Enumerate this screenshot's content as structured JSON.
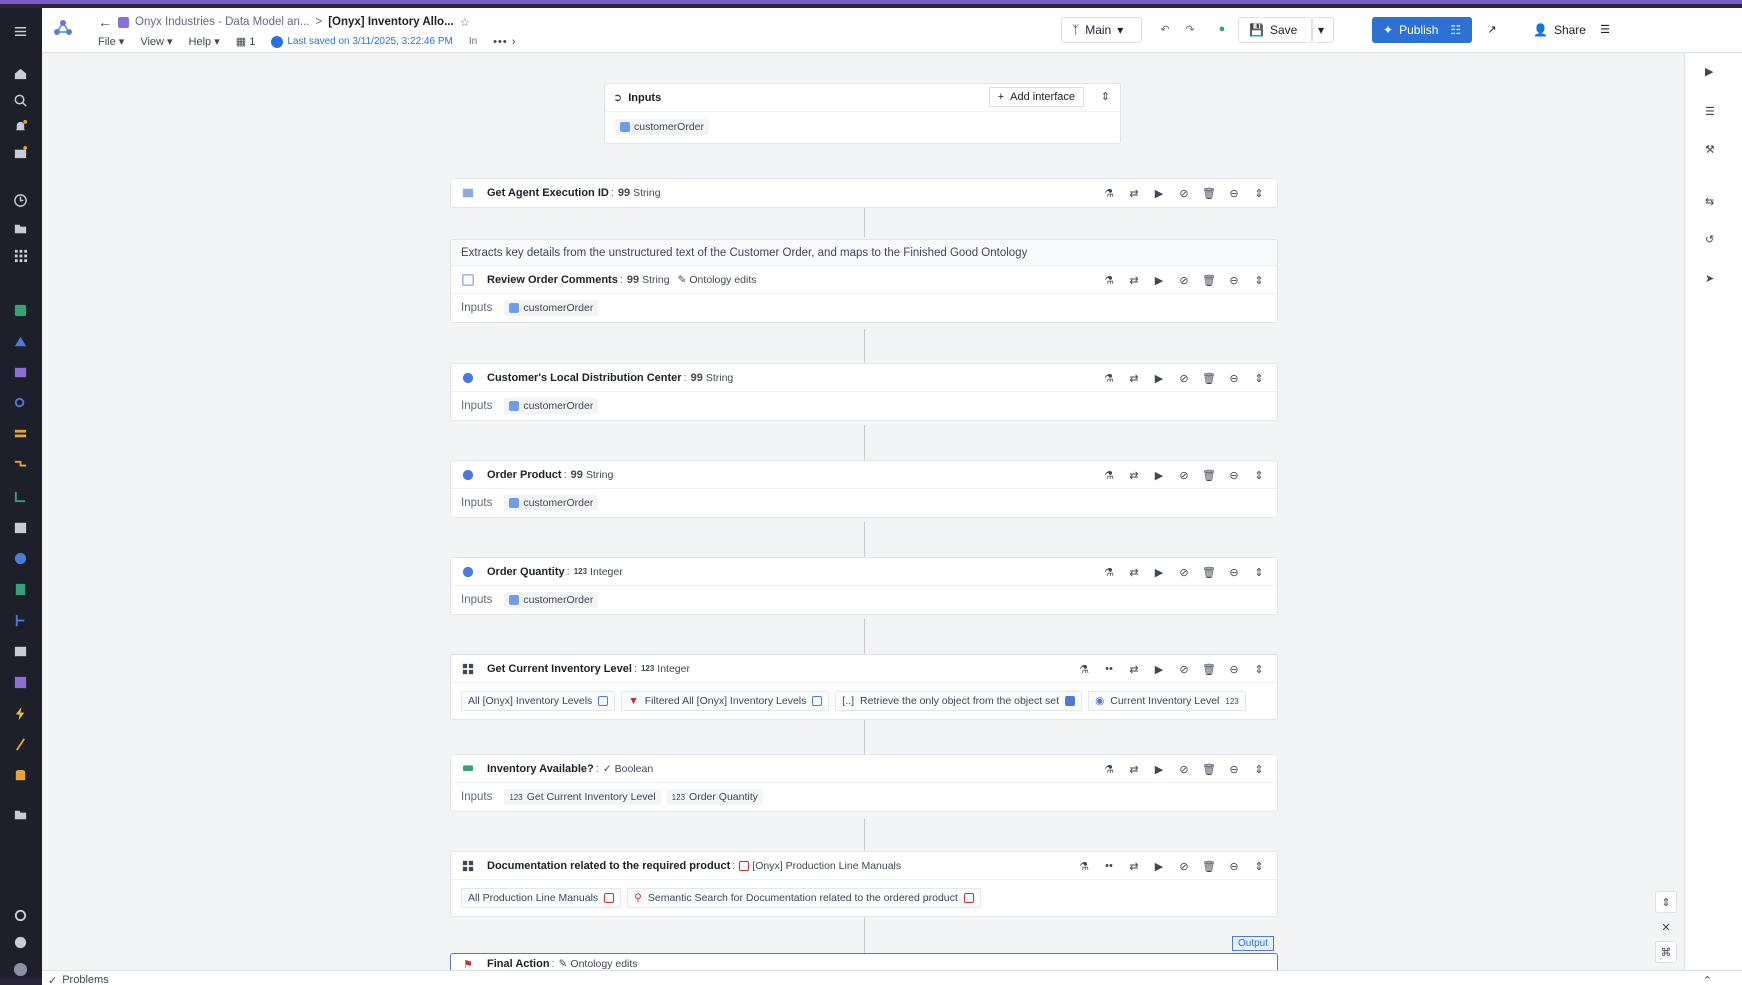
{
  "header": {
    "back_icon": "arrow-left-icon",
    "breadcrumb_project": "Onyx Industries - Data Model an...",
    "breadcrumb_separator": ">",
    "breadcrumb_current": "[Onyx] Inventory Allo...",
    "menus": [
      "File",
      "View",
      "Help"
    ],
    "branch_count": "1",
    "last_saved": "Last saved on 3/11/2025, 3:22:46 PM",
    "in_label": "In",
    "branch_label": "Main",
    "save_label": "Save",
    "publish_label": "Publish",
    "share_label": "Share"
  },
  "inputs_panel": {
    "title": "Inputs",
    "add_interface_label": "Add interface",
    "input_chip": "customerOrder"
  },
  "cards": [
    {
      "title": "Get Agent Execution ID",
      "type": "String",
      "type_glyph": "99",
      "icon": "table-icon"
    },
    {
      "description": "Extracts key details from the unstructured text of the Customer Order, and maps to the Finished Good Ontology",
      "title": "Review Order Comments",
      "type": "String",
      "type_glyph": "99",
      "extra": "Ontology edits",
      "inputs_label": "Inputs",
      "inputs": [
        "customerOrder"
      ]
    },
    {
      "title": "Customer's Local Distribution Center",
      "type": "String",
      "type_glyph": "99",
      "inputs_label": "Inputs",
      "inputs": [
        "customerOrder"
      ]
    },
    {
      "title": "Order Product",
      "type": "String",
      "type_glyph": "99",
      "inputs_label": "Inputs",
      "inputs": [
        "customerOrder"
      ]
    },
    {
      "title": "Order Quantity",
      "type": "Integer",
      "type_glyph": "123",
      "inputs_label": "Inputs",
      "inputs": [
        "customerOrder"
      ]
    },
    {
      "title": "Get Current Inventory Level",
      "type": "Integer",
      "type_glyph": "123",
      "pipeline": [
        "All [Onyx] Inventory Levels",
        "Filtered All [Onyx] Inventory Levels",
        "Retrieve the only object from the object set",
        "Current Inventory Level"
      ]
    },
    {
      "title": "Inventory Available?",
      "type": "Boolean",
      "inputs_label": "Inputs",
      "inputs": [
        "Get Current Inventory Level",
        "Order Quantity"
      ]
    },
    {
      "title": "Documentation related to the required product",
      "type": "[Onyx] Production Line Manuals",
      "pipeline": [
        "All Production Line Manuals",
        "Semantic Search for Documentation related to the ordered product"
      ]
    },
    {
      "title": "Final Action",
      "type": "Ontology edits",
      "tag": "Output"
    }
  ],
  "statusbar": {
    "problems_label": "Problems"
  },
  "colors": {
    "accent": "#2d72d2",
    "nav_bg": "#1d1f2a",
    "frame": "#7c5cc9"
  }
}
